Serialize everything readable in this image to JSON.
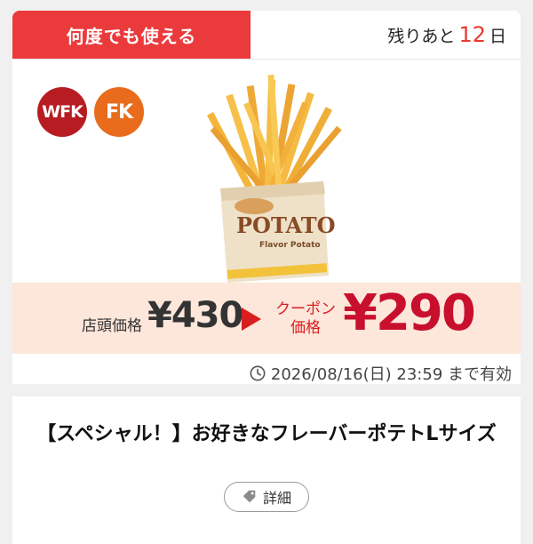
{
  "coupon": {
    "usage_label": "何度でも使える",
    "days_left_prefix": "残りあと",
    "days_left_value": "12",
    "days_left_suffix": "日",
    "badges": [
      "WFK",
      "FK"
    ],
    "shop_price_label": "店頭価格",
    "shop_price": "¥430",
    "coupon_price_label_line1": "クーポン",
    "coupon_price_label_line2": "価格",
    "coupon_price": "¥290",
    "expiry_text": "2026/08/16(日) 23:59 まで有効",
    "title": "【スペシャル！】お好きなフレーバーポテトLサイズ",
    "detail_button": "詳細",
    "product_box_text": "POTATO",
    "product_box_subtext": "Flavor Potato"
  },
  "colors": {
    "banner_red": "#eb3a3c",
    "accent_red": "#c8102e",
    "badge_wfk": "#b71c22",
    "badge_fk": "#e86c1c",
    "price_band": "#fde6da"
  },
  "icons": [
    "clock-icon",
    "tag-icon",
    "arrow-right-icon"
  ]
}
